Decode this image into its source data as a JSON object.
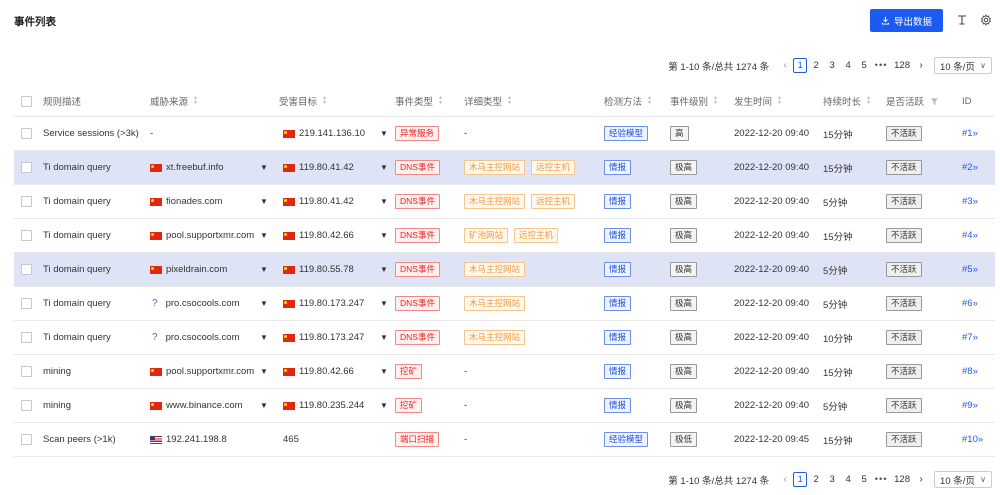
{
  "page": {
    "title": "事件列表",
    "export_label": "导出数据",
    "icons": [
      "download-icon",
      "text-height-icon",
      "settings-icon"
    ]
  },
  "pagination": {
    "total_text": "第 1-10 条/总共 1274 条",
    "pages": [
      "1",
      "2",
      "3",
      "4",
      "5"
    ],
    "ellipsis": "•••",
    "last_page": "128",
    "page_size": "10 条/页",
    "current": "1"
  },
  "columns": {
    "rule": "规则描述",
    "source": "威胁来源",
    "target": "受害目标",
    "event_type": "事件类型",
    "detail_type": "详细类型",
    "method": "检测方法",
    "level": "事件级别",
    "time": "发生时间",
    "duration": "持续时长",
    "active": "是否活跃",
    "id": "ID"
  },
  "rows": [
    {
      "rule": "Service sessions (>3k)",
      "source": "-",
      "source_flag": "",
      "target": "219.141.136.10",
      "event_type": "异常服务",
      "details": [],
      "detail_dash": "-",
      "method": "经验模型",
      "level": "高",
      "time": "2022-12-20 09:40",
      "duration": "15分钟",
      "active": "不活跃",
      "id": "#1»",
      "highlight": false
    },
    {
      "rule": "Ti domain query",
      "source": "xt.freebuf.info",
      "source_flag": "cn",
      "target": "119.80.41.42",
      "event_type": "DNS事件",
      "details": [
        "木马主控网站",
        "远控主机"
      ],
      "detail_dash": "",
      "method": "情报",
      "level": "极高",
      "time": "2022-12-20 09:40",
      "duration": "15分钟",
      "active": "不活跃",
      "id": "#2»",
      "highlight": true
    },
    {
      "rule": "Ti domain query",
      "source": "fionades.com",
      "source_flag": "cn",
      "target": "119.80.41.42",
      "event_type": "DNS事件",
      "details": [
        "木马主控网站",
        "远控主机"
      ],
      "detail_dash": "",
      "method": "情报",
      "level": "极高",
      "time": "2022-12-20 09:40",
      "duration": "5分钟",
      "active": "不活跃",
      "id": "#3»",
      "highlight": false
    },
    {
      "rule": "Ti domain query",
      "source": "pool.supportxmr.com",
      "source_flag": "cn",
      "target": "119.80.42.66",
      "event_type": "DNS事件",
      "details": [
        "矿池网站",
        "远控主机"
      ],
      "detail_dash": "",
      "method": "情报",
      "level": "极高",
      "time": "2022-12-20 09:40",
      "duration": "15分钟",
      "active": "不活跃",
      "id": "#4»",
      "highlight": false
    },
    {
      "rule": "Ti domain query",
      "source": "pixeldrain.com",
      "source_flag": "cn",
      "target": "119.80.55.78",
      "event_type": "DNS事件",
      "details": [
        "木马主控网站"
      ],
      "detail_dash": "",
      "method": "情报",
      "level": "极高",
      "time": "2022-12-20 09:40",
      "duration": "5分钟",
      "active": "不活跃",
      "id": "#5»",
      "highlight": true
    },
    {
      "rule": "Ti domain query",
      "source": "pro.csocools.com",
      "source_flag": "q",
      "target": "119.80.173.247",
      "event_type": "DNS事件",
      "details": [
        "木马主控网站"
      ],
      "detail_dash": "",
      "method": "情报",
      "level": "极高",
      "time": "2022-12-20 09:40",
      "duration": "5分钟",
      "active": "不活跃",
      "id": "#6»",
      "highlight": false
    },
    {
      "rule": "Ti domain query",
      "source": "pro.csocools.com",
      "source_flag": "q",
      "target": "119.80.173.247",
      "event_type": "DNS事件",
      "details": [
        "木马主控网站"
      ],
      "detail_dash": "",
      "method": "情报",
      "level": "极高",
      "time": "2022-12-20 09:40",
      "duration": "10分钟",
      "active": "不活跃",
      "id": "#7»",
      "highlight": false
    },
    {
      "rule": "mining",
      "source": "pool.supportxmr.com",
      "source_flag": "cn",
      "target": "119.80.42.66",
      "event_type": "挖矿",
      "details": [],
      "detail_dash": "-",
      "method": "情报",
      "level": "极高",
      "time": "2022-12-20 09:40",
      "duration": "15分钟",
      "active": "不活跃",
      "id": "#8»",
      "highlight": false
    },
    {
      "rule": "mining",
      "source": "www.binance.com",
      "source_flag": "cn",
      "target": "119.80.235.244",
      "event_type": "挖矿",
      "details": [],
      "detail_dash": "-",
      "method": "情报",
      "level": "极高",
      "time": "2022-12-20 09:40",
      "duration": "5分钟",
      "active": "不活跃",
      "id": "#9»",
      "highlight": false
    },
    {
      "rule": "Scan peers (>1k)",
      "source": "192.241.198.8",
      "source_flag": "us",
      "target": "465",
      "event_type": "端口扫描",
      "details": [],
      "detail_dash": "-",
      "method": "经验模型",
      "level": "极低",
      "time": "2022-12-20 09:45",
      "duration": "15分钟",
      "active": "不活跃",
      "id": "#10»",
      "highlight": false
    }
  ]
}
